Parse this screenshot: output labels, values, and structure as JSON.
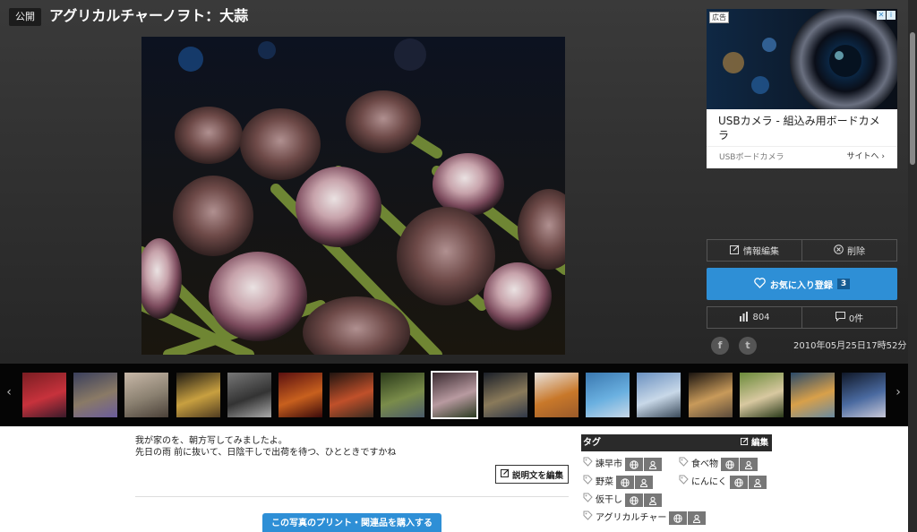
{
  "header": {
    "visibility": "公開",
    "title": "アグリカルチャーノヲト：大蒜"
  },
  "ad": {
    "label": "広告",
    "info_icon": "info-icon",
    "close_icon": "close-icon",
    "title": "USBカメラ - 組込み用ボードカメラ",
    "domain": "USBボードカメラ",
    "link": "サイトへ"
  },
  "actions": {
    "edit_info": "情報編集",
    "delete": "削除",
    "favorite": "お気に入り登録",
    "favorite_count": "3",
    "views": "804",
    "comments": "0件"
  },
  "social": {
    "facebook": "f",
    "twitter": "t"
  },
  "date": "2010年05月25日17時52分",
  "filmstrip": {
    "prev": "‹",
    "next": "›",
    "thumbs": [
      {
        "name": "thumb-red-alley",
        "colors": [
          "#7a1d22",
          "#c7323c",
          "#3b1a2a"
        ]
      },
      {
        "name": "thumb-night-street",
        "colors": [
          "#3a3f5c",
          "#8a7a66",
          "#6a5c9c"
        ]
      },
      {
        "name": "thumb-sunset-sky",
        "colors": [
          "#c8b8a8",
          "#8a8070",
          "#4a4038"
        ]
      },
      {
        "name": "thumb-night-market",
        "colors": [
          "#1e1a14",
          "#c8a040",
          "#503c20"
        ]
      },
      {
        "name": "thumb-bw-market",
        "colors": [
          "#777",
          "#333",
          "#aaa"
        ]
      },
      {
        "name": "thumb-cat-red",
        "colors": [
          "#5a1010",
          "#c8601e",
          "#3a0a0a"
        ]
      },
      {
        "name": "thumb-lantern-street",
        "colors": [
          "#201410",
          "#c0502a",
          "#3a2a20"
        ]
      },
      {
        "name": "thumb-rice-terrace",
        "colors": [
          "#2a3a1a",
          "#7a8c4a",
          "#4a5a6a"
        ]
      },
      {
        "name": "thumb-garlic",
        "colors": [
          "#3a2a30",
          "#b89aa0",
          "#2a3a20"
        ],
        "selected": true
      },
      {
        "name": "thumb-night-table",
        "colors": [
          "#1a1f28",
          "#8a7a5a",
          "#303848"
        ]
      },
      {
        "name": "thumb-onions",
        "colors": [
          "#e8e2dc",
          "#c8782a",
          "#9a5a2a"
        ]
      },
      {
        "name": "thumb-blue-car",
        "colors": [
          "#3a78b0",
          "#6ab0e0",
          "#c8d8e8"
        ]
      },
      {
        "name": "thumb-harbor",
        "colors": [
          "#6a90c0",
          "#c8d8e8",
          "#3a4a5a"
        ]
      },
      {
        "name": "thumb-shop-window",
        "colors": [
          "#1a1410",
          "#c89a5a",
          "#5a4a3a"
        ]
      },
      {
        "name": "thumb-box-green",
        "colors": [
          "#6a8a3a",
          "#d8c8a0",
          "#2a3a1a"
        ]
      },
      {
        "name": "thumb-beach-sunset",
        "colors": [
          "#2a4a6a",
          "#d8a04a",
          "#6a8aa0"
        ]
      },
      {
        "name": "thumb-night-bus",
        "colors": [
          "#101828",
          "#4a6aa0",
          "#c8c8d8"
        ]
      }
    ]
  },
  "description": {
    "line1": "我が家のを、朝方写してみましたよ。",
    "line2": "先日の雨 前に抜いて、日陰干しで出荷を待つ、ひとときですかね",
    "edit": "説明文を編集",
    "buy": "この写真のプリント・関連品を購入する"
  },
  "tags": {
    "header": "タグ",
    "edit": "編集",
    "items": [
      "諫早市",
      "食べ物",
      "野菜",
      "にんにく",
      "仮干し",
      "アグリカルチャー"
    ]
  }
}
